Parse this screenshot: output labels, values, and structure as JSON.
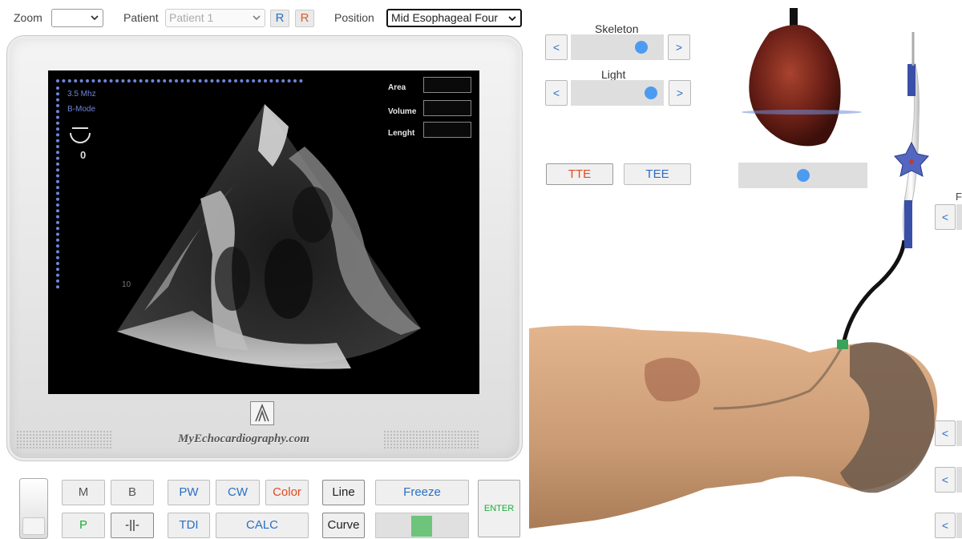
{
  "toolbar": {
    "zoom_label": "Zoom",
    "zoom_value": "",
    "patient_label": "Patient",
    "patient_value": "Patient 1",
    "r_blue": "R",
    "r_red": "R",
    "position_label": "Position",
    "position_value": "Mid Esophageal Four"
  },
  "screen": {
    "frequency": "3.5 Mhz",
    "mode": "B-Mode",
    "angle": "0",
    "depth_marker": "10",
    "measure": {
      "area": "Area",
      "volume": "Volume",
      "length": "Lenght"
    }
  },
  "monitor": {
    "brand": "MyEchocardiography.com"
  },
  "controls": {
    "m": "M",
    "b": "B",
    "pw": "PW",
    "cw": "CW",
    "color": "Color",
    "line": "Line",
    "freeze": "Freeze",
    "p": "P",
    "caliper": "-||-",
    "tdi": "TDI",
    "calc": "CALC",
    "curve": "Curve",
    "enter": "ENTER"
  },
  "right_panel": {
    "skeleton_label": "Skeleton",
    "skeleton_level": 0.8,
    "light_label": "Light",
    "light_level": 0.92,
    "prev": "<",
    "next": ">",
    "tte": "TTE",
    "tee": "TEE",
    "probe_level": 0.5,
    "edge_letter": "F"
  },
  "colors": {
    "accent_blue": "#2a6fc4",
    "accent_red": "#e24a1f",
    "knob": "#4c9bf0",
    "freeze_indicator": "#6dc47a"
  }
}
